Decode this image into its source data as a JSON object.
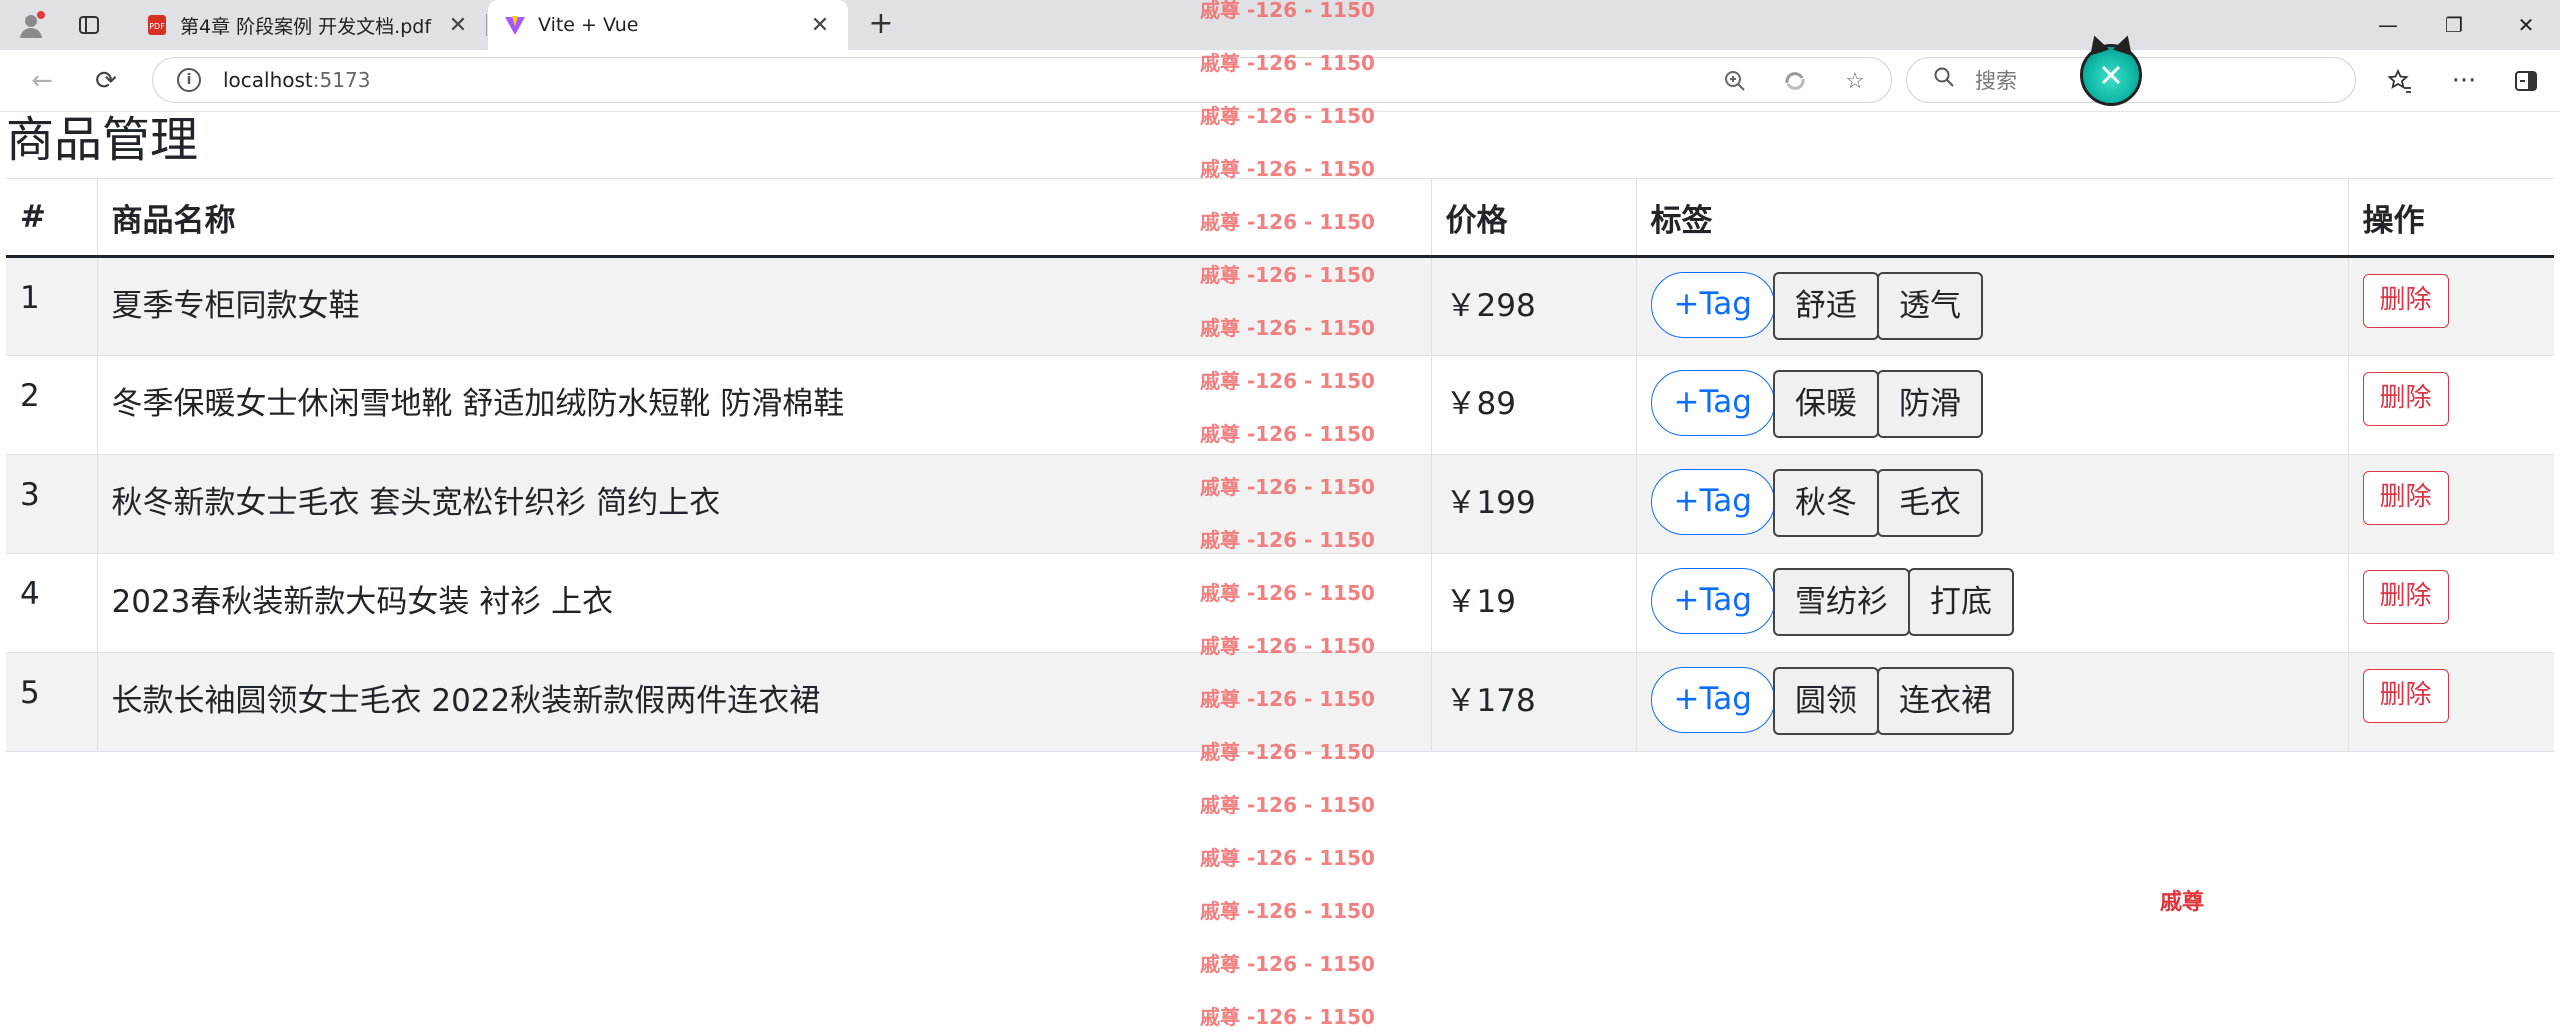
{
  "browser": {
    "tabs": [
      {
        "title": "第4章 阶段案例 开发文档.pdf",
        "icon": "pdf-icon",
        "active": false
      },
      {
        "title": "Vite + Vue",
        "icon": "vite-icon",
        "active": true
      }
    ],
    "url_host": "localhost",
    "url_port": ":5173",
    "search_placeholder": "搜索"
  },
  "page": {
    "title": "商品管理",
    "columns": [
      "#",
      "商品名称",
      "价格",
      "标签",
      "操作"
    ],
    "add_tag_label": "+Tag",
    "delete_label": "删除",
    "rows": [
      {
        "id": "1",
        "name": "夏季专柜同款女鞋",
        "price": "￥298",
        "tags": [
          "舒适",
          "透气"
        ]
      },
      {
        "id": "2",
        "name": "冬季保暖女士休闲雪地靴 舒适加绒防水短靴 防滑棉鞋",
        "price": "￥89",
        "tags": [
          "保暖",
          "防滑"
        ]
      },
      {
        "id": "3",
        "name": "秋冬新款女士毛衣 套头宽松针织衫 简约上衣",
        "price": "￥199",
        "tags": [
          "秋冬",
          "毛衣"
        ]
      },
      {
        "id": "4",
        "name": "2023春秋装新款大码女装 衬衫 上衣",
        "price": "￥19",
        "tags": [
          "雪纺衫",
          "打底"
        ]
      },
      {
        "id": "5",
        "name": "长款长袖圆领女士毛衣 2022秋装新款假两件连衣裙",
        "price": "￥178",
        "tags": [
          "圆领",
          "连衣裙"
        ]
      }
    ]
  },
  "watermark": {
    "text": "戚尊 -126 - 1150",
    "repeat": 20,
    "extra": "戚尊"
  },
  "colors": {
    "primary": "#0d6efd",
    "danger": "#dc3545",
    "watermark": "#f06b6b"
  }
}
